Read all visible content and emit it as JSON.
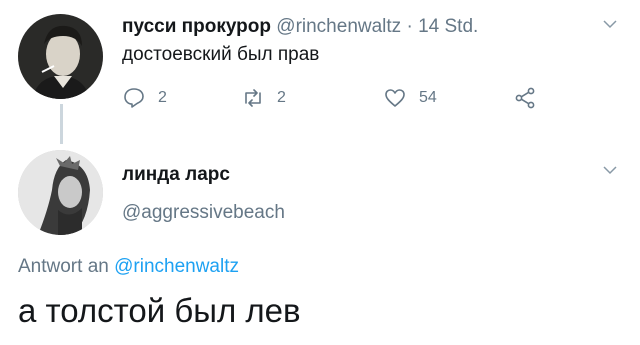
{
  "tweet": {
    "author_name": "пусси прокурор",
    "author_handle": "@rinchenwaltz",
    "separator": "·",
    "timestamp": "14 Std.",
    "text": "достоевский был прав",
    "actions": {
      "reply_count": "2",
      "retweet_count": "2",
      "like_count": "54"
    }
  },
  "reply_card": {
    "author_name": "линда ларс",
    "author_handle": "@aggressivebeach",
    "replying_to_prefix": "Antwort an",
    "replying_to_handle": "@rinchenwaltz",
    "text": "а толстой был лев"
  },
  "colors": {
    "text": "#14171a",
    "muted": "#657786",
    "link": "#1da1f2",
    "thread_line": "#ccd6dd"
  },
  "icons": [
    "chevron-down-icon",
    "reply-icon",
    "retweet-icon",
    "like-icon",
    "share-icon"
  ]
}
